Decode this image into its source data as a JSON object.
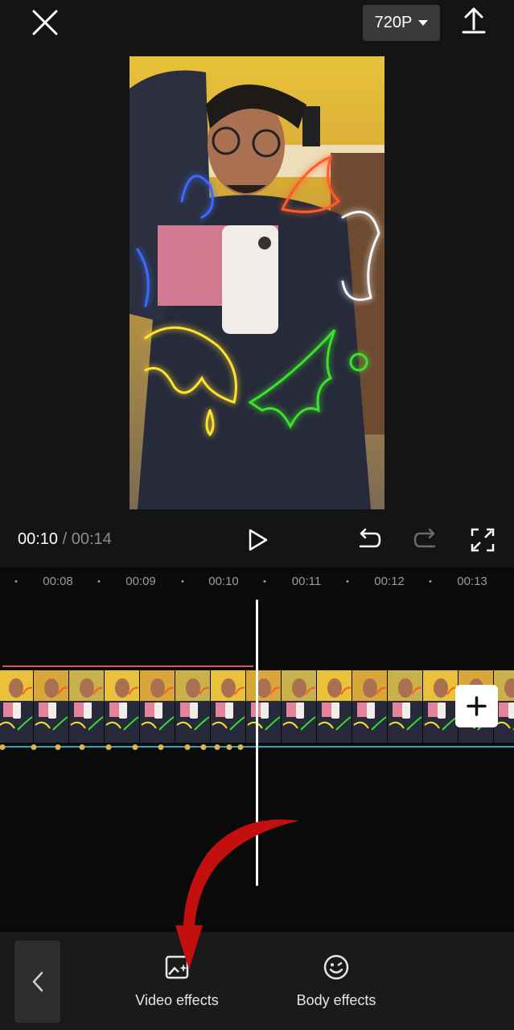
{
  "topbar": {
    "close_icon": "close-icon",
    "resolution_label": "720P",
    "export_icon": "upload-icon"
  },
  "playback": {
    "current_time": "00:10",
    "separator": "/",
    "total_time": "00:14",
    "play_icon": "play-icon",
    "undo_icon": "undo-icon",
    "redo_icon": "redo-icon",
    "fullscreen_icon": "fullscreen-icon"
  },
  "timeline": {
    "ruler_labels": [
      "00:08",
      "00:09",
      "00:10",
      "00:11",
      "00:12",
      "00:13"
    ],
    "add_clip_icon": "plus-icon"
  },
  "bottom_toolbar": {
    "back_icon": "chevron-left-icon",
    "video_effects_label": "Video effects",
    "body_effects_label": "Body effects"
  },
  "colors": {
    "effect_track": "#e0505a",
    "keyframe": "#e0b44a",
    "audio_line": "#27a9b6",
    "annotation_arrow": "#c40f0f"
  }
}
